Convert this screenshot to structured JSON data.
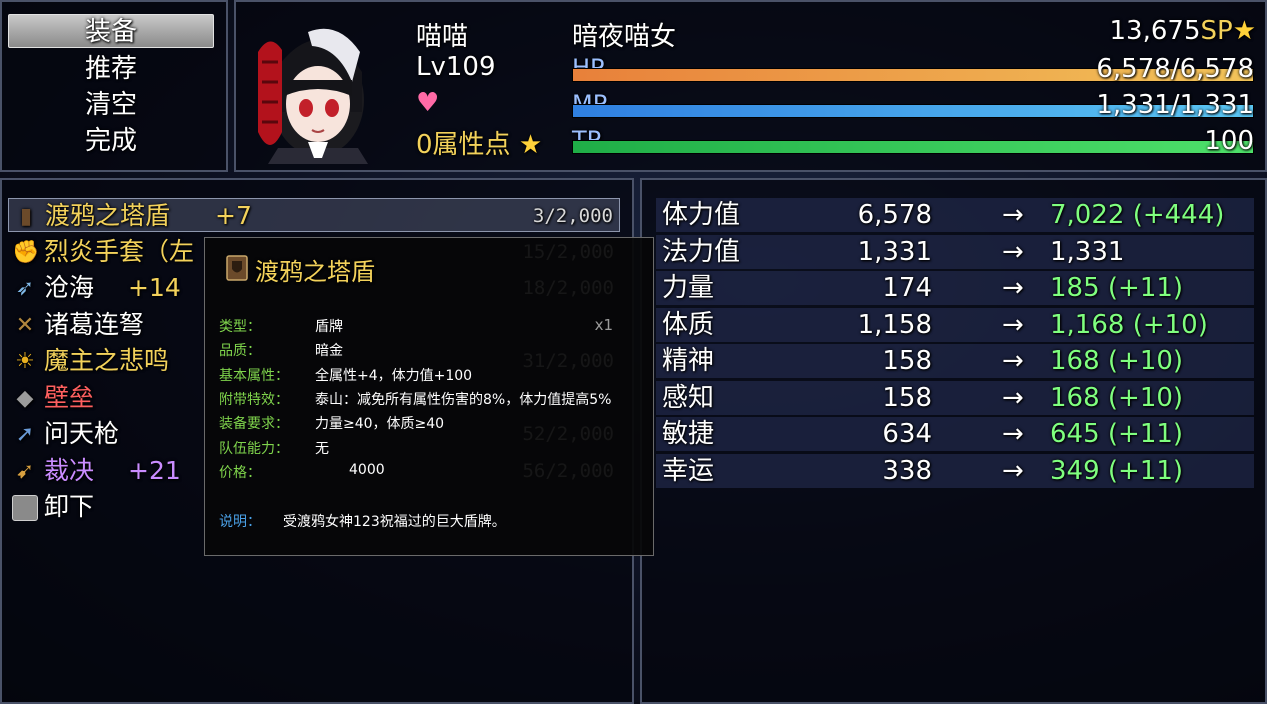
{
  "colors": {
    "yellow": "#f3d25b",
    "green": "#7fff7f",
    "red": "#ff6060",
    "purple": "#c98cff",
    "hp": "#e9a04f",
    "mp": "#3ea6ea",
    "tp": "#3ad15b"
  },
  "command": {
    "items": [
      "装备",
      "推荐",
      "清空",
      "完成"
    ]
  },
  "actor": {
    "name": "喵喵",
    "level": "Lv109",
    "points": "0属性点",
    "title": "暗夜喵女",
    "sp": "13,675",
    "sp_unit": "SP",
    "hp_label": "HP",
    "hp_value": "6,578/6,578",
    "hp_ratio": 1.0,
    "mp_label": "MP",
    "mp_value": "1,331/1,331",
    "mp_ratio": 1.0,
    "tp_label": "TP",
    "tp_value": "100",
    "tp_ratio": 1.0
  },
  "items": [
    {
      "name": "渡鸦之塔盾",
      "plus": "+7",
      "count": "3/2,000",
      "icon": "shield-icon"
    },
    {
      "name": "烈炎手套（左",
      "plus": "",
      "count": "15/2,000",
      "icon": "gauntlet-icon"
    },
    {
      "name": "沧海",
      "plus": "+14",
      "count": "18/2,000",
      "icon": "spear-icon"
    },
    {
      "name": "诸葛连弩",
      "plus": "",
      "count": "",
      "icon": "crossbow-icon"
    },
    {
      "name": "魔主之悲鸣",
      "plus": "",
      "count": "31/2,000",
      "icon": "skull-icon"
    },
    {
      "name": "壁垒",
      "plus": "",
      "count": "",
      "icon": "shield-spike-icon"
    },
    {
      "name": "问天枪",
      "plus": "",
      "count": "52/2,000",
      "icon": "lance-icon"
    },
    {
      "name": "裁决",
      "plus": "+21",
      "count": "56/2,000",
      "icon": "gun-icon"
    },
    {
      "name": "卸下",
      "plus": "",
      "count": "",
      "icon": "empty-slot-icon"
    }
  ],
  "compare": [
    {
      "name": "体力值",
      "cur": "6,578",
      "arrow": "→",
      "new": "7,022 (+444)",
      "up": true
    },
    {
      "name": "法力值",
      "cur": "1,331",
      "arrow": "→",
      "new": "1,331",
      "up": false
    },
    {
      "name": "力量",
      "cur": "174",
      "arrow": "→",
      "new": "185 (+11)",
      "up": true
    },
    {
      "name": "体质",
      "cur": "1,158",
      "arrow": "→",
      "new": "1,168 (+10)",
      "up": true
    },
    {
      "name": "精神",
      "cur": "158",
      "arrow": "→",
      "new": "168 (+10)",
      "up": true
    },
    {
      "name": "感知",
      "cur": "158",
      "arrow": "→",
      "new": "168 (+10)",
      "up": true
    },
    {
      "name": "敏捷",
      "cur": "634",
      "arrow": "→",
      "new": "645 (+11)",
      "up": true
    },
    {
      "name": "幸运",
      "cur": "338",
      "arrow": "→",
      "new": "349 (+11)",
      "up": true
    }
  ],
  "tooltip": {
    "title": "渡鸦之塔盾",
    "qty": "x1",
    "rows": [
      {
        "label": "类型：",
        "value": "盾牌"
      },
      {
        "label": "品质：",
        "value": "暗金"
      },
      {
        "label": "基本属性：",
        "value": "全属性+4，体力值+100"
      },
      {
        "label": "附带特效：",
        "value": "泰山：减免所有属性伤害的8%，体力值提高5%"
      },
      {
        "label": "装备要求：",
        "value": "力量≥40，体质≥40"
      },
      {
        "label": "队伍能力：",
        "value": "无"
      },
      {
        "label": "价格：",
        "value": "4000"
      }
    ],
    "desc_label": "说明：",
    "desc": "受渡鸦女神123祝福过的巨大盾牌。"
  }
}
